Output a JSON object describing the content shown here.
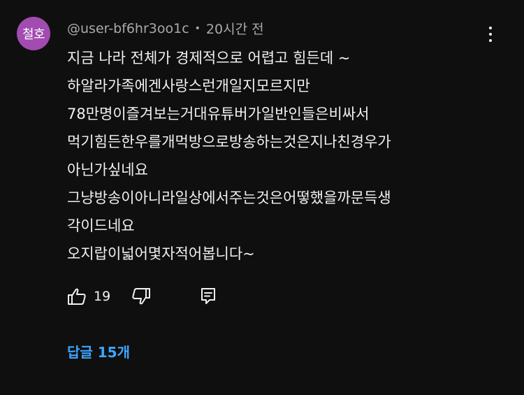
{
  "comment": {
    "avatar_text": "철호",
    "avatar_color": "#a24bb0",
    "author": "@user-bf6hr3oo1c",
    "separator": "•",
    "timestamp": "20시간 전",
    "text_lines": [
      "지금 나라 전체가 경제적으로 어렵고 힘든데 ~",
      "하알라가족에겐사랑스런개일지모르지만",
      "78만명이즐겨보는거대유튜버가일반인들은비싸서",
      "먹기힘든한우를개먹방으로방송하는것은지나친경우가",
      "아닌가싶네요",
      "그냥방송이아니라일상에서주는것은어떻했을까문득생",
      "각이드네요",
      "오지랍이넓어몇자적어봅니다~"
    ],
    "like_count": "19",
    "replies_label": "답글 15개",
    "replies_color": "#3ea6ff",
    "icons": {
      "menu": "more-vert-icon",
      "like": "thumb-up-icon",
      "dislike": "thumb-down-icon",
      "reply": "reply-icon"
    }
  }
}
